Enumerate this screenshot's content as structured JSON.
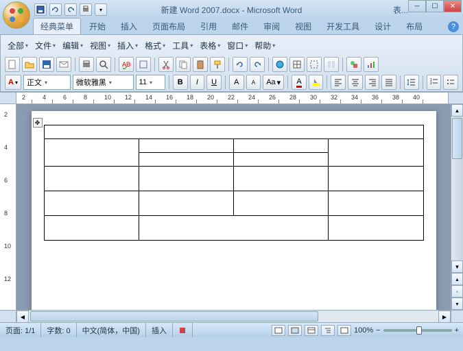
{
  "title": {
    "doc": "新建 Word 2007.docx",
    "app": "Microsoft Word",
    "extra": "表..."
  },
  "tabs": [
    "经典菜单",
    "开始",
    "插入",
    "页面布局",
    "引用",
    "邮件",
    "审阅",
    "视图",
    "开发工具",
    "设计",
    "布局"
  ],
  "active_tab": 0,
  "menu": [
    "全部",
    "文件",
    "编辑",
    "视图",
    "插入",
    "格式",
    "工具",
    "表格",
    "窗口",
    "帮助"
  ],
  "style_combo": "正文",
  "font_combo": "微软雅黑",
  "size_combo": "11",
  "status": {
    "page": "页面: 1/1",
    "words": "字数: 0",
    "lang": "中文(简体，中国)",
    "mode": "插入",
    "zoom": "100%"
  },
  "ruler_h": [
    2,
    4,
    6,
    8,
    10,
    12,
    14,
    16,
    18,
    20,
    22,
    24,
    26,
    28,
    30,
    32,
    34,
    36,
    38,
    40
  ],
  "ruler_v": [
    2,
    4,
    6,
    8,
    10,
    12
  ]
}
